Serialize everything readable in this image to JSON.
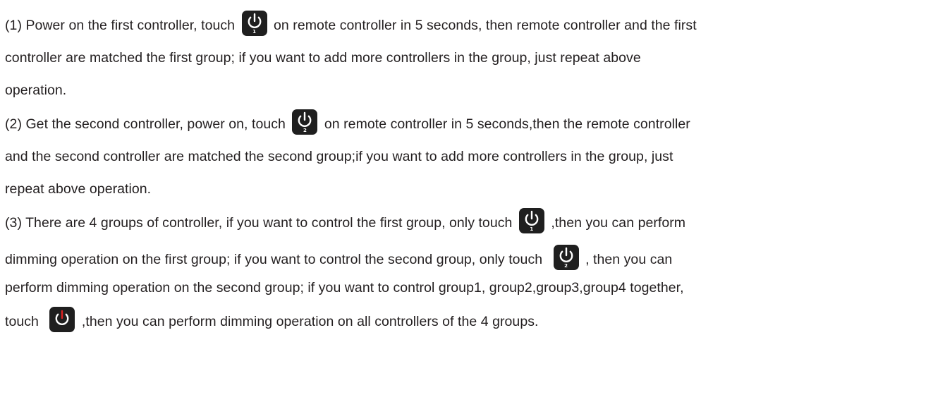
{
  "paragraphs": {
    "p1": {
      "l1_a": "(1) Power on the first controller, touch",
      "l1_b": "on remote controller in 5 seconds, then remote controller and the first",
      "l2": "controller are matched the first group; if you want to add more controllers in the group, just repeat above",
      "l3": "operation."
    },
    "p2": {
      "l1_a": "(2) Get the second controller, power on, touch",
      "l1_b": "on remote controller in 5 seconds,then the remote controller",
      "l2": "and the second controller are matched the second group;if you want to add more controllers in the group, just",
      "l3": "repeat above operation."
    },
    "p3": {
      "l1_a": "(3) There are 4 groups of controller, if you want to control the first group, only touch",
      "l1_b": ",then you can perform",
      "l2_a": "dimming operation on the first group; if you want to control the second group, only touch",
      "l2_b": ", then you can",
      "l3": "perform dimming operation on the second group; if you want to control group1, group2,group3,group4 together,",
      "l4_a": "touch",
      "l4_b": ",then you can perform dimming operation on all controllers of the 4 groups."
    }
  },
  "buttons": {
    "group1_label": "1",
    "group2_label": "2",
    "icon": "power-icon",
    "colors": {
      "button_bg": "#1f1f1f",
      "icon_white": "#ffffff",
      "icon_red": "#e02020"
    }
  }
}
